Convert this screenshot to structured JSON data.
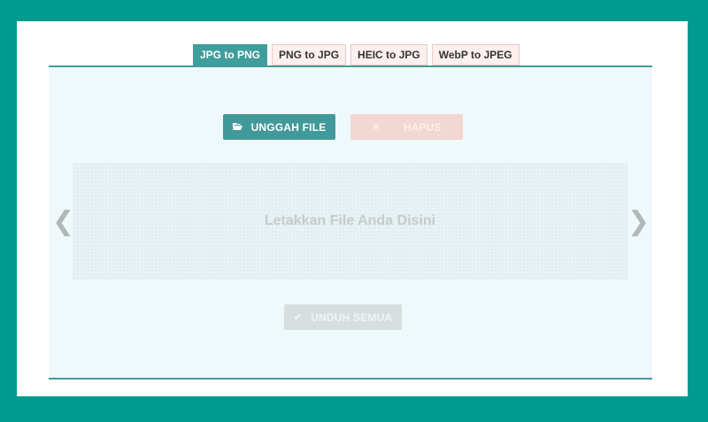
{
  "tabs": [
    {
      "label": "JPG to PNG",
      "active": true
    },
    {
      "label": "PNG to JPG",
      "active": false
    },
    {
      "label": "HEIC to JPG",
      "active": false
    },
    {
      "label": "WebP to JPEG",
      "active": false
    }
  ],
  "actions": {
    "upload_label": "UNGGAH FILE",
    "upload_icon": "folder-open-icon",
    "delete_label": "HAPUS",
    "delete_icon": "close-icon",
    "download_all_label": "UNDUH SEMUA",
    "download_icon": "check-icon"
  },
  "dropzone": {
    "placeholder": "Letakkan File Anda Disini"
  },
  "carousel": {
    "prev_glyph": "❮",
    "next_glyph": "❯"
  },
  "colors": {
    "page_bg": "#009a8e",
    "accent": "#3f9e9b",
    "panel_bg": "#eff8fa"
  }
}
